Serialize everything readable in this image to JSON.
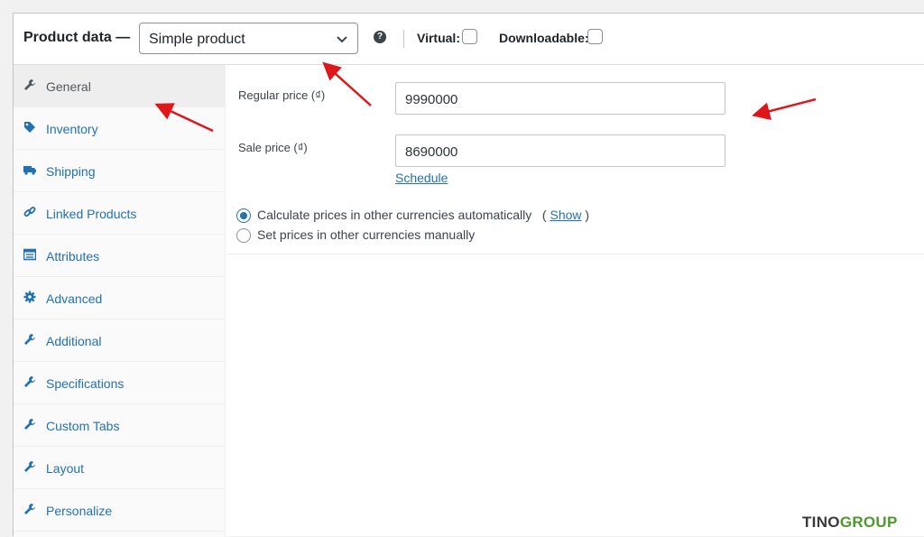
{
  "header": {
    "title": "Product data —",
    "product_type": "Simple product",
    "help_icon": "question-circle-icon",
    "virtual_label": "Virtual:",
    "virtual_checked": false,
    "downloadable_label": "Downloadable:",
    "downloadable_checked": false
  },
  "sidebar": {
    "active": "General",
    "items": [
      {
        "label": "General",
        "icon": "wrench-icon"
      },
      {
        "label": "Inventory",
        "icon": "tag-icon"
      },
      {
        "label": "Shipping",
        "icon": "truck-icon"
      },
      {
        "label": "Linked Products",
        "icon": "link-icon"
      },
      {
        "label": "Attributes",
        "icon": "table-icon"
      },
      {
        "label": "Advanced",
        "icon": "gear-icon"
      },
      {
        "label": "Additional",
        "icon": "wrench-icon"
      },
      {
        "label": "Specifications",
        "icon": "wrench-icon"
      },
      {
        "label": "Custom Tabs",
        "icon": "wrench-icon"
      },
      {
        "label": "Layout",
        "icon": "wrench-icon"
      },
      {
        "label": "Personalize",
        "icon": "wrench-icon"
      }
    ]
  },
  "general": {
    "regular_price_label": "Regular price (₫)",
    "regular_price_value": "9990000",
    "sale_price_label": "Sale price (₫)",
    "sale_price_value": "8690000",
    "schedule_link": "Schedule",
    "currency_options": [
      {
        "label": "Calculate prices in other currencies automatically",
        "selected": true
      },
      {
        "label": "Set prices in other currencies manually",
        "selected": false
      }
    ],
    "show_prefix": "(",
    "show_link": "Show",
    "show_suffix": ")"
  },
  "watermark": {
    "part1": "TINO",
    "part2": "GROUP"
  },
  "colors": {
    "accent": "#2271b1",
    "arrow": "#e0161b",
    "brand_green": "#4c9a2a"
  }
}
